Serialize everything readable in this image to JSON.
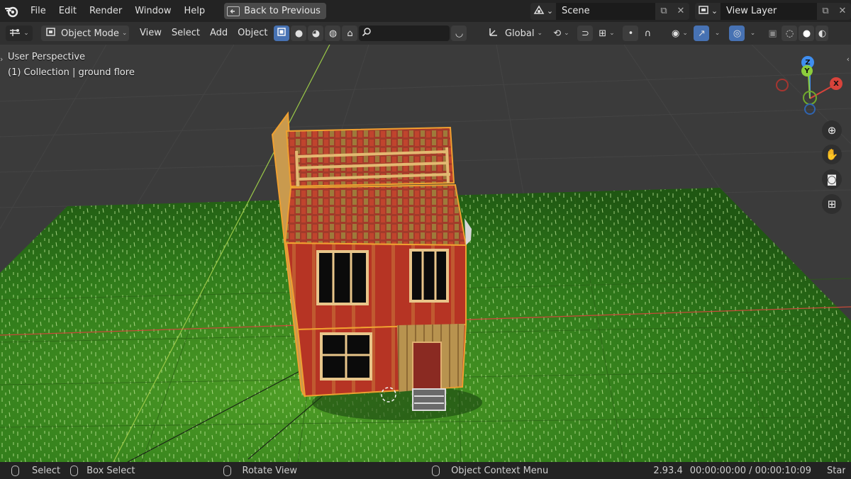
{
  "menu": {
    "items": [
      "File",
      "Edit",
      "Render",
      "Window",
      "Help"
    ],
    "back_button": "Back to Previous"
  },
  "scene": {
    "label": "Scene"
  },
  "view_layer": {
    "label": "View Layer"
  },
  "header": {
    "mode": "Object Mode",
    "menus": [
      "View",
      "Select",
      "Add",
      "Object"
    ],
    "search_placeholder": "",
    "transform_orientation": "Global"
  },
  "viewport": {
    "perspective": "User Perspective",
    "collection": "(1) Collection | ground flore"
  },
  "gizmo": {
    "z": "Z",
    "y": "Y",
    "x": "X"
  },
  "statusbar": {
    "select": "Select",
    "box_select": "Box Select",
    "rotate_view": "Rotate View",
    "context_menu": "Object Context Menu",
    "version": "2.93.4",
    "timecode": "00:00:00:00 / 00:00:10:09",
    "trailing": "Star"
  },
  "colors": {
    "accent": "#4772b3",
    "selection_outline": "#f0a030",
    "x_axis": "#d8433b",
    "y_axis": "#8ccc3c",
    "z_axis": "#3f8ef0",
    "ground": "#3a8a1f",
    "house_red": "#b53424"
  }
}
